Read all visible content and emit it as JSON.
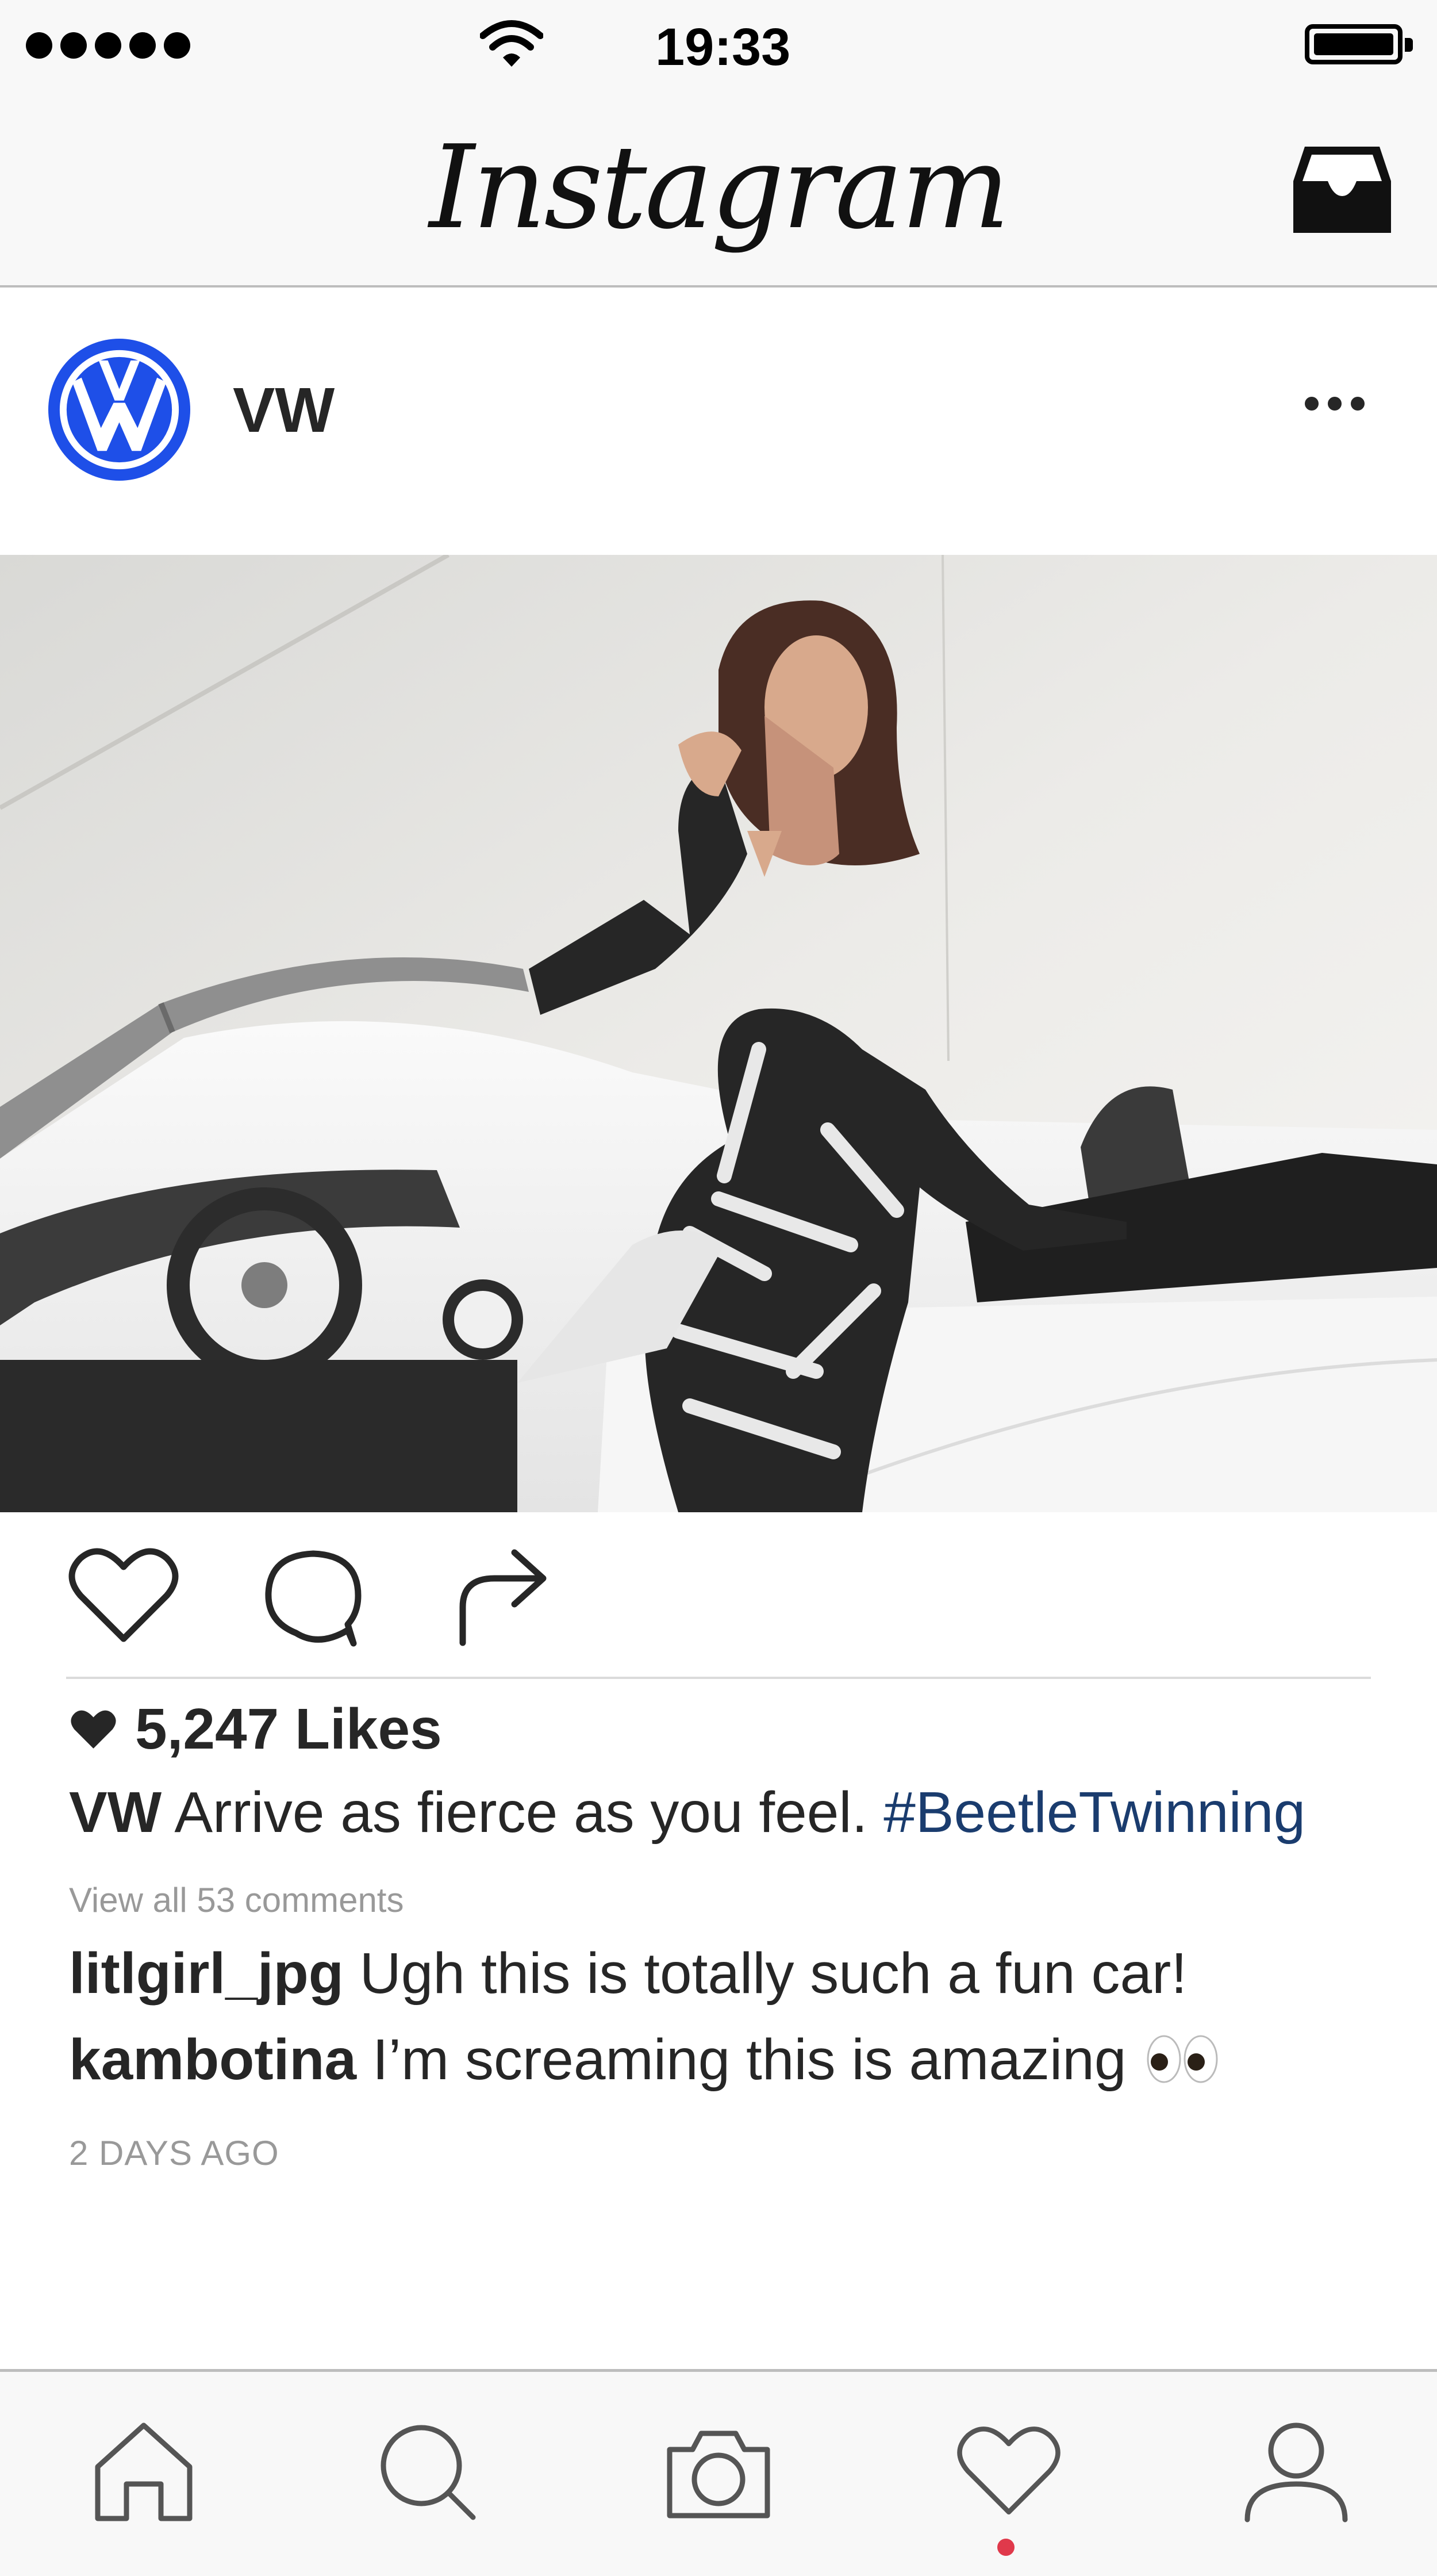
{
  "status_bar": {
    "time": "19:33",
    "signal_icon": "signal-dots-icon",
    "wifi_icon": "wifi-icon",
    "battery_icon": "battery-icon",
    "battery_level": 1.0
  },
  "nav_bar": {
    "app_title": "Instagram",
    "inbox_icon": "inbox-icon"
  },
  "post": {
    "account_name": "VW",
    "avatar_icon": "vw-logo-icon",
    "more_icon": "more-dots-icon",
    "photo_alt": "Woman in black and white patterned outfit sitting on a white convertible Beetle",
    "actions": {
      "like_icon": "heart-outline-icon",
      "comment_icon": "comment-bubble-icon",
      "share_icon": "share-arrow-icon"
    },
    "likes": "5,247 Likes",
    "caption": {
      "user": "VW",
      "text": "Arrive as fierce as you feel.",
      "hashtag": "#BeetleTwinning"
    },
    "view_all_comments": "View all 53 comments",
    "comments": [
      {
        "user": "litlgirl_jpg",
        "text": "Ugh this is totally such a fun car!"
      },
      {
        "user": "kambotina",
        "text": "I’m screaming this is amazing"
      }
    ],
    "timestamp": "2 DAYS AGO"
  },
  "tab_bar": {
    "tabs": [
      {
        "icon": "home-icon"
      },
      {
        "icon": "search-icon"
      },
      {
        "icon": "camera-icon"
      },
      {
        "icon": "heart-activity-icon"
      },
      {
        "icon": "profile-icon"
      }
    ],
    "accent_color": "#e0394b"
  },
  "colors": {
    "bar_background": "#f8f8f8",
    "hashtag": "#1a3c6e",
    "vw_blue": "#1e4fe8",
    "muted_text": "#999999"
  }
}
